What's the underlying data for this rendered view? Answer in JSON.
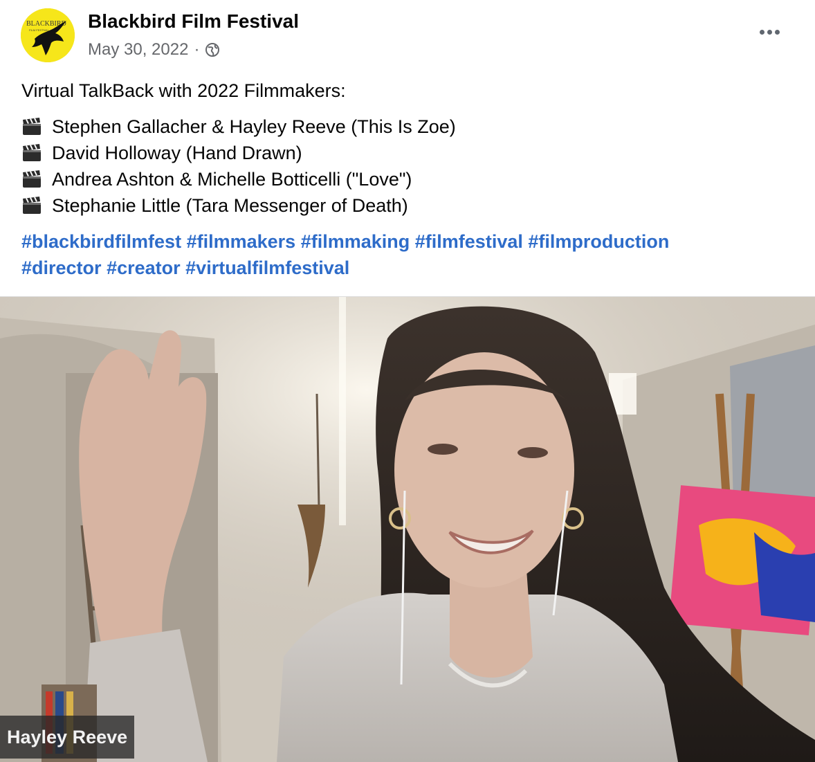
{
  "post": {
    "author": "Blackbird Film Festival",
    "date": "May 30, 2022",
    "separator": "·",
    "audience_icon": "globe-icon",
    "avatar_logo_text": "BLACKBIRD",
    "avatar_logo_subtext": "FILM FESTIVAL",
    "intro": "Virtual TalkBack with 2022 Filmmakers:",
    "films": [
      "Stephen Gallacher & Hayley Reeve (This Is Zoe)",
      "David Holloway (Hand Drawn)",
      "Andrea Ashton & Michelle Botticelli (\"Love\")",
      "Stephanie Little (Tara Messenger of Death)"
    ],
    "hashtags": [
      "#blackbirdfilmfest",
      "#filmmakers",
      "#filmmaking",
      "#filmfestival",
      "#filmproduction",
      "#director",
      "#creator",
      "#virtualfilmfestival"
    ]
  },
  "video": {
    "participant_name": "Hayley Reeve"
  },
  "colors": {
    "hashtag": "#2e6cc9",
    "meta": "#65676b",
    "avatar_bg": "#f6e61a"
  }
}
